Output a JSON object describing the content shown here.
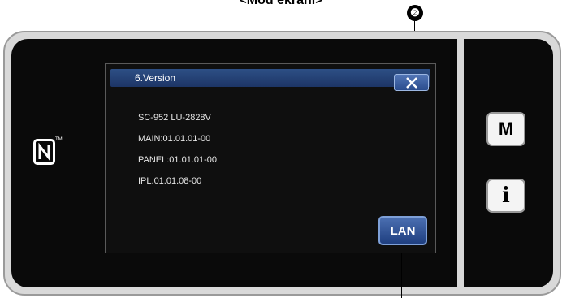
{
  "caption": "<Mod ekranı>",
  "dialog": {
    "title": "6.Version",
    "close_icon": "close-x-icon",
    "lines": [
      "SC-952 LU-2828V",
      "MAIN:01.01.01-00",
      "PANEL:01.01.01-00",
      "IPL.01.01.08-00"
    ],
    "lan_label": "LAN"
  },
  "side_buttons": {
    "mode_label": "M",
    "info_label": "i"
  },
  "nfc_icon": "nfc-icon",
  "nfc_tm": "TM",
  "callout_number": "❷",
  "colors": {
    "title_bar": "#2d4f85",
    "button": "#3a5fa0",
    "callout_dot": "#d01818"
  }
}
